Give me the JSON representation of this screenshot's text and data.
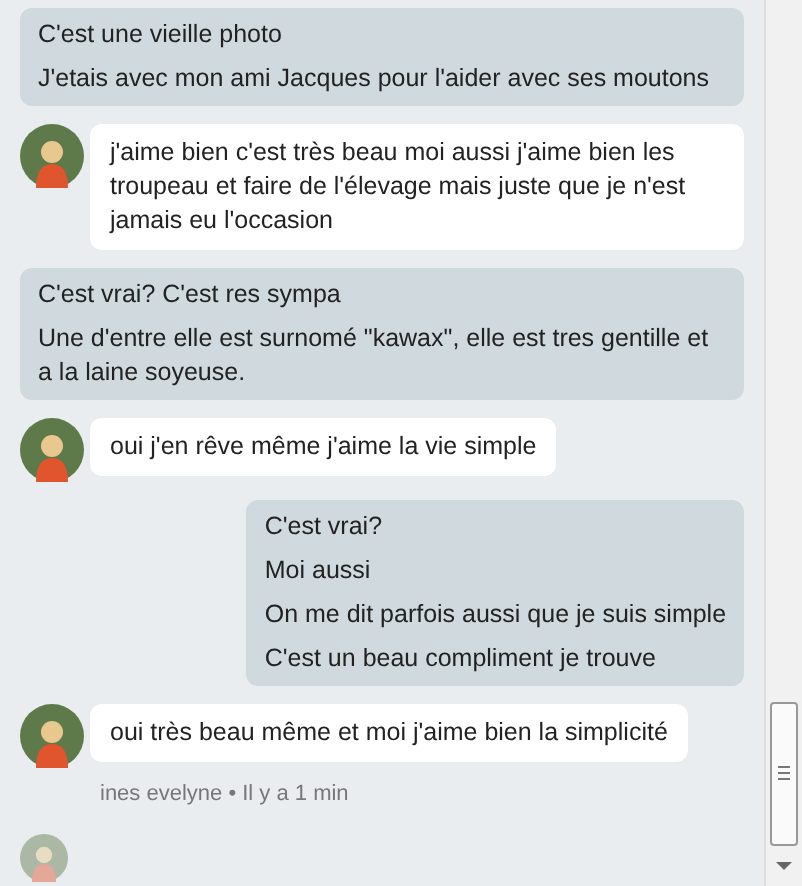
{
  "messages": [
    {
      "kind": "sent",
      "full_width": true,
      "lines": [
        "C'est une vieille photo",
        "J'etais avec mon ami Jacques pour l'aider avec ses moutons"
      ]
    },
    {
      "kind": "received",
      "lines": [
        "j'aime bien c'est très beau moi aussi j'aime bien les troupeau et faire de l'élevage mais juste que je n'est jamais eu l'occasion"
      ]
    },
    {
      "kind": "sent",
      "full_width": true,
      "lines": [
        "C'est vrai? C'est res sympa",
        "Une d'entre elle est surnomé \"kawax\", elle est tres gentille et a la laine soyeuse."
      ]
    },
    {
      "kind": "received",
      "lines": [
        "oui j'en rêve même j'aime la vie simple"
      ]
    },
    {
      "kind": "sent",
      "full_width": false,
      "lines": [
        "C'est vrai?",
        "Moi aussi",
        "On me dit parfois aussi que je suis simple",
        "C'est un beau compliment je trouve"
      ]
    },
    {
      "kind": "received",
      "lines": [
        "oui très beau même et moi j'aime bien la simplicité"
      ]
    }
  ],
  "meta": "ines evelyne • Il y a 1 min"
}
